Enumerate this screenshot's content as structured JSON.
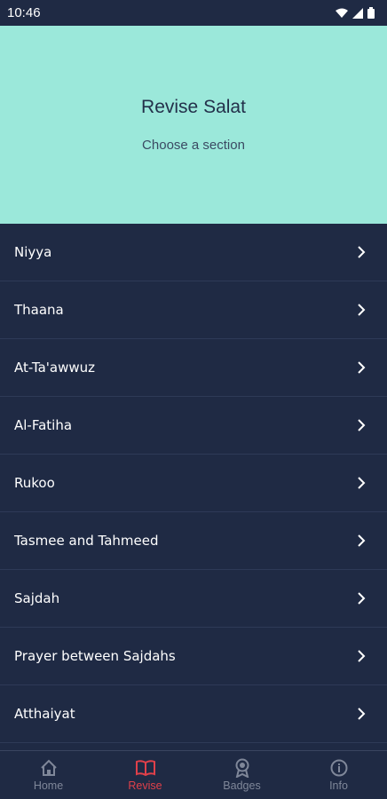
{
  "status": {
    "time": "10:46",
    "icons": [
      "wifi-icon",
      "signal-icon",
      "battery-icon"
    ]
  },
  "header": {
    "title": "Revise Salat",
    "subtitle": "Choose a section",
    "bg_color": "#9be8da"
  },
  "sections": [
    {
      "label": "Niyya"
    },
    {
      "label": "Thaana"
    },
    {
      "label": "At-Ta'awwuz"
    },
    {
      "label": "Al-Fatiha"
    },
    {
      "label": "Rukoo"
    },
    {
      "label": "Tasmee and Tahmeed"
    },
    {
      "label": "Sajdah"
    },
    {
      "label": "Prayer between Sajdahs"
    },
    {
      "label": "Atthaiyat"
    }
  ],
  "nav": [
    {
      "label": "Home",
      "icon": "home-icon",
      "active": false
    },
    {
      "label": "Revise",
      "icon": "book-icon",
      "active": true
    },
    {
      "label": "Badges",
      "icon": "badge-icon",
      "active": false
    },
    {
      "label": "Info",
      "icon": "info-icon",
      "active": false
    }
  ],
  "colors": {
    "background": "#1f2a44",
    "accent": "#e0404a",
    "header": "#9be8da"
  }
}
